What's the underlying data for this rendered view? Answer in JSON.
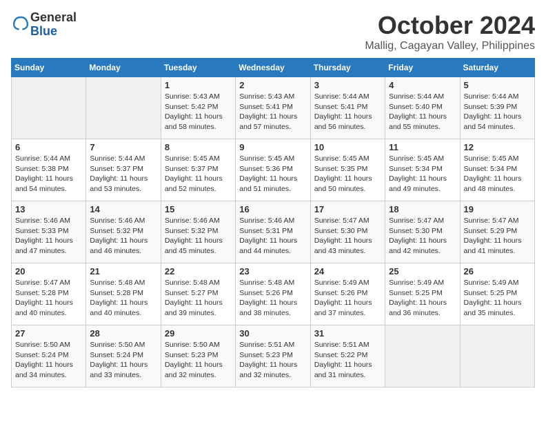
{
  "logo": {
    "line1": "General",
    "line2": "Blue"
  },
  "title": "October 2024",
  "subtitle": "Mallig, Cagayan Valley, Philippines",
  "headers": [
    "Sunday",
    "Monday",
    "Tuesday",
    "Wednesday",
    "Thursday",
    "Friday",
    "Saturday"
  ],
  "weeks": [
    [
      {
        "day": "",
        "info": ""
      },
      {
        "day": "",
        "info": ""
      },
      {
        "day": "1",
        "info": "Sunrise: 5:43 AM\nSunset: 5:42 PM\nDaylight: 11 hours\nand 58 minutes."
      },
      {
        "day": "2",
        "info": "Sunrise: 5:43 AM\nSunset: 5:41 PM\nDaylight: 11 hours\nand 57 minutes."
      },
      {
        "day": "3",
        "info": "Sunrise: 5:44 AM\nSunset: 5:41 PM\nDaylight: 11 hours\nand 56 minutes."
      },
      {
        "day": "4",
        "info": "Sunrise: 5:44 AM\nSunset: 5:40 PM\nDaylight: 11 hours\nand 55 minutes."
      },
      {
        "day": "5",
        "info": "Sunrise: 5:44 AM\nSunset: 5:39 PM\nDaylight: 11 hours\nand 54 minutes."
      }
    ],
    [
      {
        "day": "6",
        "info": "Sunrise: 5:44 AM\nSunset: 5:38 PM\nDaylight: 11 hours\nand 54 minutes."
      },
      {
        "day": "7",
        "info": "Sunrise: 5:44 AM\nSunset: 5:37 PM\nDaylight: 11 hours\nand 53 minutes."
      },
      {
        "day": "8",
        "info": "Sunrise: 5:45 AM\nSunset: 5:37 PM\nDaylight: 11 hours\nand 52 minutes."
      },
      {
        "day": "9",
        "info": "Sunrise: 5:45 AM\nSunset: 5:36 PM\nDaylight: 11 hours\nand 51 minutes."
      },
      {
        "day": "10",
        "info": "Sunrise: 5:45 AM\nSunset: 5:35 PM\nDaylight: 11 hours\nand 50 minutes."
      },
      {
        "day": "11",
        "info": "Sunrise: 5:45 AM\nSunset: 5:34 PM\nDaylight: 11 hours\nand 49 minutes."
      },
      {
        "day": "12",
        "info": "Sunrise: 5:45 AM\nSunset: 5:34 PM\nDaylight: 11 hours\nand 48 minutes."
      }
    ],
    [
      {
        "day": "13",
        "info": "Sunrise: 5:46 AM\nSunset: 5:33 PM\nDaylight: 11 hours\nand 47 minutes."
      },
      {
        "day": "14",
        "info": "Sunrise: 5:46 AM\nSunset: 5:32 PM\nDaylight: 11 hours\nand 46 minutes."
      },
      {
        "day": "15",
        "info": "Sunrise: 5:46 AM\nSunset: 5:32 PM\nDaylight: 11 hours\nand 45 minutes."
      },
      {
        "day": "16",
        "info": "Sunrise: 5:46 AM\nSunset: 5:31 PM\nDaylight: 11 hours\nand 44 minutes."
      },
      {
        "day": "17",
        "info": "Sunrise: 5:47 AM\nSunset: 5:30 PM\nDaylight: 11 hours\nand 43 minutes."
      },
      {
        "day": "18",
        "info": "Sunrise: 5:47 AM\nSunset: 5:30 PM\nDaylight: 11 hours\nand 42 minutes."
      },
      {
        "day": "19",
        "info": "Sunrise: 5:47 AM\nSunset: 5:29 PM\nDaylight: 11 hours\nand 41 minutes."
      }
    ],
    [
      {
        "day": "20",
        "info": "Sunrise: 5:47 AM\nSunset: 5:28 PM\nDaylight: 11 hours\nand 40 minutes."
      },
      {
        "day": "21",
        "info": "Sunrise: 5:48 AM\nSunset: 5:28 PM\nDaylight: 11 hours\nand 40 minutes."
      },
      {
        "day": "22",
        "info": "Sunrise: 5:48 AM\nSunset: 5:27 PM\nDaylight: 11 hours\nand 39 minutes."
      },
      {
        "day": "23",
        "info": "Sunrise: 5:48 AM\nSunset: 5:26 PM\nDaylight: 11 hours\nand 38 minutes."
      },
      {
        "day": "24",
        "info": "Sunrise: 5:49 AM\nSunset: 5:26 PM\nDaylight: 11 hours\nand 37 minutes."
      },
      {
        "day": "25",
        "info": "Sunrise: 5:49 AM\nSunset: 5:25 PM\nDaylight: 11 hours\nand 36 minutes."
      },
      {
        "day": "26",
        "info": "Sunrise: 5:49 AM\nSunset: 5:25 PM\nDaylight: 11 hours\nand 35 minutes."
      }
    ],
    [
      {
        "day": "27",
        "info": "Sunrise: 5:50 AM\nSunset: 5:24 PM\nDaylight: 11 hours\nand 34 minutes."
      },
      {
        "day": "28",
        "info": "Sunrise: 5:50 AM\nSunset: 5:24 PM\nDaylight: 11 hours\nand 33 minutes."
      },
      {
        "day": "29",
        "info": "Sunrise: 5:50 AM\nSunset: 5:23 PM\nDaylight: 11 hours\nand 32 minutes."
      },
      {
        "day": "30",
        "info": "Sunrise: 5:51 AM\nSunset: 5:23 PM\nDaylight: 11 hours\nand 32 minutes."
      },
      {
        "day": "31",
        "info": "Sunrise: 5:51 AM\nSunset: 5:22 PM\nDaylight: 11 hours\nand 31 minutes."
      },
      {
        "day": "",
        "info": ""
      },
      {
        "day": "",
        "info": ""
      }
    ]
  ]
}
